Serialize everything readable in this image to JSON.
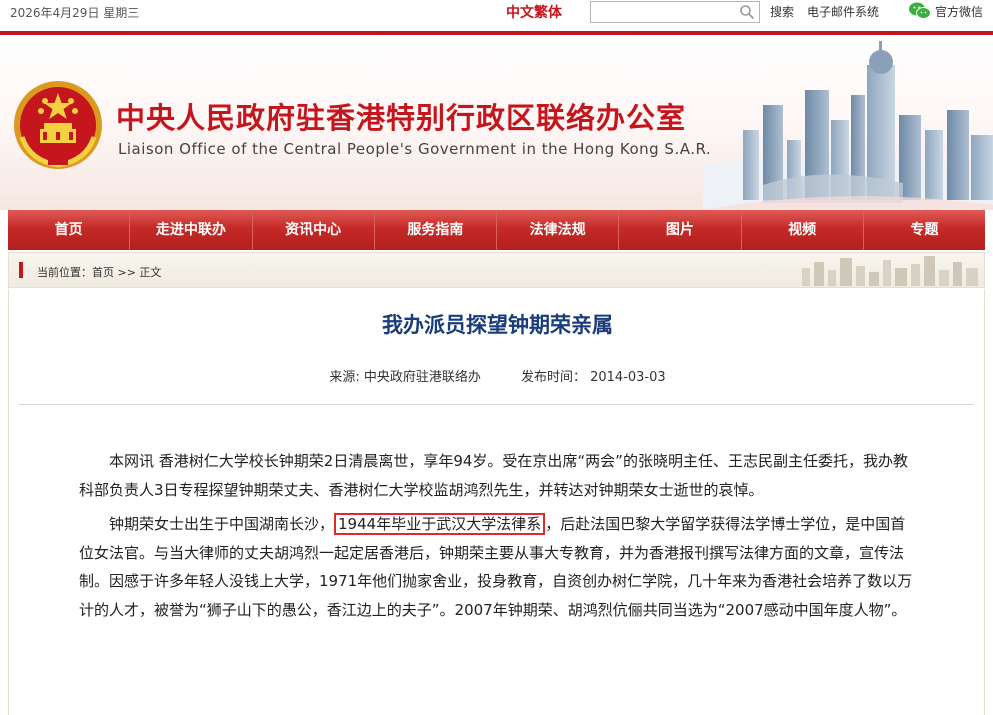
{
  "topbar": {
    "date": "2026年4月29日  星期三",
    "lang": "中文繁体",
    "search_placeholder": "",
    "search_label": "搜索",
    "mail_label": "电子邮件系统",
    "wechat_label": "官方微信"
  },
  "banner": {
    "cn_title": "中央人民政府驻香港特别行政区联络办公室",
    "en_title": "Liaison Office of the Central People's Government in the Hong Kong S.A.R."
  },
  "nav": [
    "首页",
    "走进中联办",
    "资讯中心",
    "服务指南",
    "法律法规",
    "图片",
    "视频",
    "专题"
  ],
  "breadcrumb": "当前位置：首页 >> 正文",
  "article": {
    "title": "我办派员探望钟期荣亲属",
    "source": "来源: 中央政府驻港联络办",
    "publish_time": "发布时间： 2014-03-03",
    "p1": "本网讯 香港树仁大学校长钟期荣2日清晨离世，享年94岁。受在京出席“两会”的张晓明主任、王志民副主任委托，我办教科部负责人3日专程探望钟期荣丈夫、香港树仁大学校监胡鸿烈先生，并转达对钟期荣女士逝世的哀悼。",
    "p2_before": "钟期荣女士出生于中国湖南长沙，",
    "p2_highlight": "1944年毕业于武汉大学法律系",
    "p2_after": "，后赴法国巴黎大学留学获得法学博士学位，是中国首位女法官。与当大律师的丈夫胡鸿烈一起定居香港后，钟期荣主要从事大专教育，并为香港报刊撰写法律方面的文章，宣传法制。因感于许多年轻人没钱上大学，1971年他们抛家舍业，投身教育，自资创办树仁学院，几十年来为香港社会培养了数以万计的人才，被誉为“狮子山下的愚公，香江边上的夫子”。2007年钟期荣、胡鸿烈伉俪共同当选为“2007感动中国年度人物”。"
  },
  "colors": {
    "brand_red": "#c4161c",
    "title_blue": "#1a3d7a",
    "highlight_border": "#e02a2a"
  }
}
